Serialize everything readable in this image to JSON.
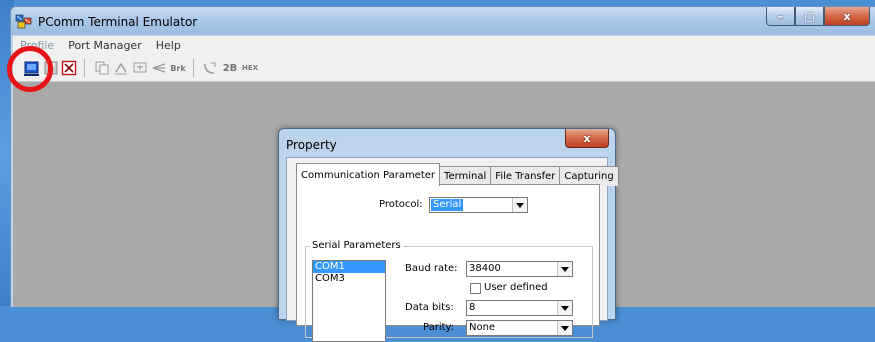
{
  "window": {
    "title": "PComm Terminal Emulator"
  },
  "window_buttons": {
    "minimize": "–",
    "maximize": "□",
    "close": "x"
  },
  "menu": [
    {
      "label": "Profile"
    },
    {
      "label": "Port Manager"
    },
    {
      "label": "Help"
    }
  ],
  "toolbar": {
    "break_label": "Brk",
    "twob_label": "2B",
    "hex_label": "HEX"
  },
  "highlight_color": "#e8141a",
  "dialog": {
    "title": "Property",
    "close": "x",
    "tabs": [
      {
        "label": "Communication Parameter",
        "active": true
      },
      {
        "label": "Terminal"
      },
      {
        "label": "File Transfer"
      },
      {
        "label": "Capturing"
      }
    ],
    "protocol": {
      "label": "Protocol:",
      "value": "Serial"
    },
    "serial_group": {
      "title": "Serial Parameters",
      "ports": [
        {
          "label": "COM1",
          "selected": true
        },
        {
          "label": "COM3"
        }
      ],
      "baud_rate": {
        "label": "Baud rate:",
        "value": "38400"
      },
      "user_defined": {
        "label": "User defined",
        "checked": false
      },
      "data_bits": {
        "label": "Data bits:",
        "value": "8"
      },
      "parity": {
        "label": "Parity:",
        "value": "None"
      }
    }
  }
}
